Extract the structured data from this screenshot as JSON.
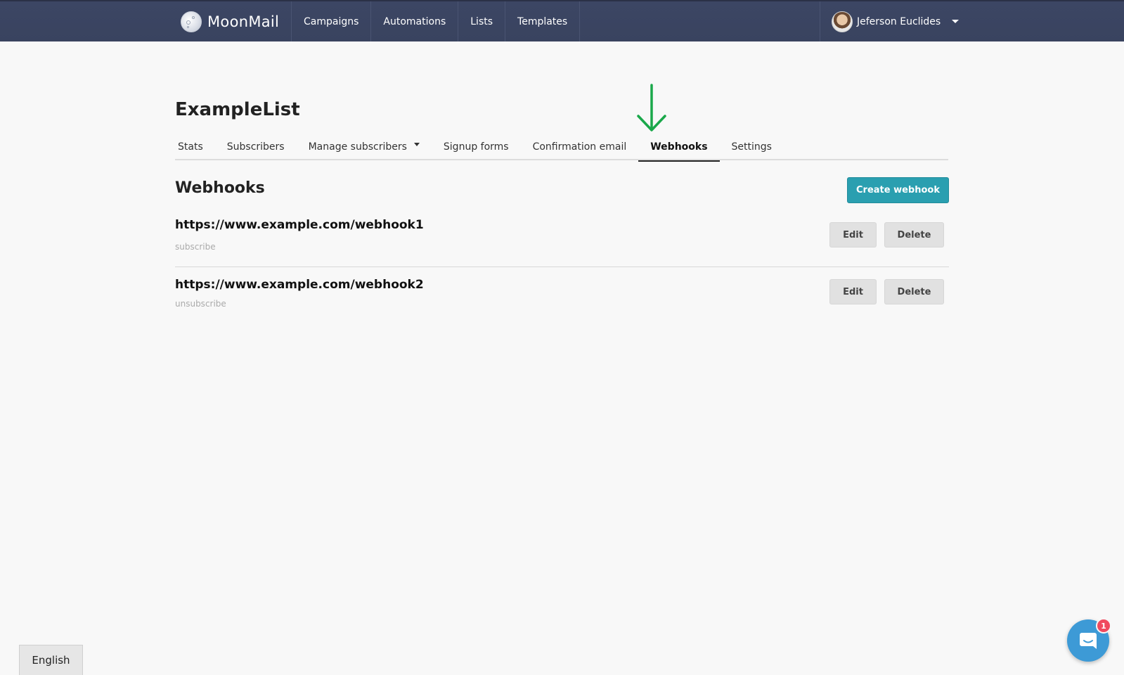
{
  "navbar": {
    "brand": "MoonMail",
    "items": [
      {
        "label": "Campaigns"
      },
      {
        "label": "Automations"
      },
      {
        "label": "Lists"
      },
      {
        "label": "Templates"
      }
    ],
    "user": {
      "name": "Jeferson Euclides"
    }
  },
  "page": {
    "title": "ExampleList",
    "tabs": [
      {
        "label": "Stats"
      },
      {
        "label": "Subscribers"
      },
      {
        "label": "Manage subscribers"
      },
      {
        "label": "Signup forms"
      },
      {
        "label": "Confirmation email"
      },
      {
        "label": "Webhooks",
        "active": true
      },
      {
        "label": "Settings"
      }
    ]
  },
  "webhooks": {
    "title": "Webhooks",
    "create_label": "Create webhook",
    "items": [
      {
        "url": "https://www.example.com/webhook1",
        "event": "subscribe",
        "edit_label": "Edit",
        "delete_label": "Delete"
      },
      {
        "url": "https://www.example.com/webhook2",
        "event": "unsubscribe",
        "edit_label": "Edit",
        "delete_label": "Delete"
      }
    ]
  },
  "footer": {
    "language_label": "English",
    "chat_badge_count": "1"
  },
  "colors": {
    "navbar": "#3c4664",
    "accent": "#2a9fb0",
    "annotation_arrow": "#1aa84a",
    "badge": "#f04a5e",
    "chat": "#3d9ad6"
  },
  "icons": {
    "brand": "moon-logo-icon",
    "user_menu": "chevron-down-icon",
    "annotation": "arrow-down-icon",
    "chat": "chat-icon"
  }
}
